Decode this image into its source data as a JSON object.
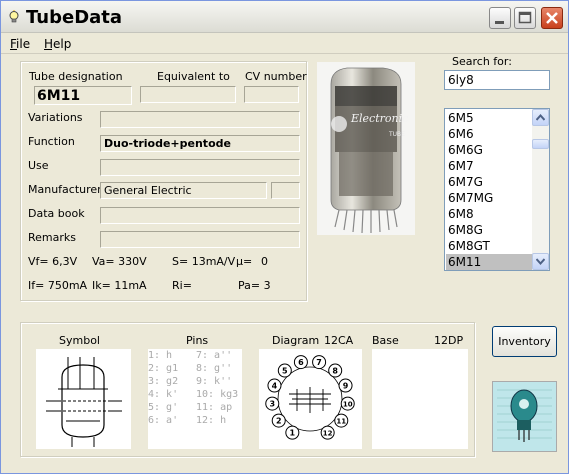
{
  "window": {
    "title": "TubeData"
  },
  "menu": {
    "file": "File",
    "help": "Help"
  },
  "fields": {
    "designation_label": "Tube designation",
    "equivalent_label": "Equivalent to",
    "cv_label": "CV number",
    "designation_value": "6M11",
    "equivalent_value": "",
    "cv_value": "",
    "variations_label": "Variations",
    "variations_value": "",
    "function_label": "Function",
    "function_value": "Duo-triode+pentode",
    "use_label": "Use",
    "use_value": "",
    "manufacturer_label": "Manufacturer",
    "manufacturer_value": "General Electric",
    "manufacturer_extra": "",
    "databook_label": "Data book",
    "databook_value": "",
    "remarks_label": "Remarks",
    "remarks_value": ""
  },
  "specs": {
    "vf": "Vf= 6,3V",
    "va": "Va= 330V",
    "s": "S= 13mA/V",
    "mu": "µ=",
    "mu_val": "0",
    "if": "If= 750mA",
    "ik": "Ik= 11mA",
    "ri": "Ri=",
    "pa": "Pa= 3"
  },
  "search": {
    "label": "Search for:",
    "value": "6ly8"
  },
  "tube_list": {
    "items": [
      "6M5",
      "6M6",
      "6M6G",
      "6M7",
      "6M7G",
      "6M7MG",
      "6M8",
      "6M8G",
      "6M8GT",
      "6M11"
    ],
    "selected": "6M11"
  },
  "bottom": {
    "symbol_label": "Symbol",
    "pins_label": "Pins",
    "diagram_label": "Diagram",
    "diagram_code": "12CA",
    "base_label": "Base",
    "base_code": "12DP",
    "pins": [
      [
        "1: h",
        "7: a''"
      ],
      [
        "2: g1",
        "8: g''"
      ],
      [
        "3: g2",
        "9: k''"
      ],
      [
        "4: k'",
        "10: kg3"
      ],
      [
        "5: g'",
        "11: ap"
      ],
      [
        "6: a'",
        "12: h"
      ]
    ],
    "diagram_pins": [
      "1",
      "2",
      "3",
      "4",
      "5",
      "6",
      "7",
      "8",
      "9",
      "10",
      "11",
      "12"
    ]
  },
  "inventory_button": "Inventory",
  "photo": {
    "brand_text": "Electronic",
    "tube_text": "TUBE"
  },
  "colors": {
    "title_close": "#c8401c",
    "list_selected": "#c0c0c0",
    "pin_text": "#aaaaaa"
  }
}
